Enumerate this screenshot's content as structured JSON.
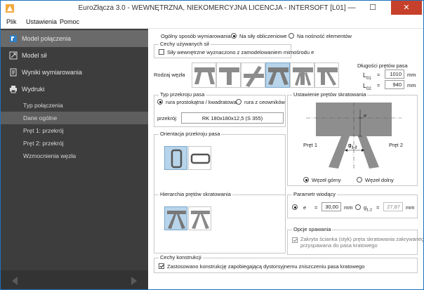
{
  "window": {
    "title": "EuroZłącza 3.0 - WEWNĘTRZNA, NIEKOMERCYJNA LICENCJA - INTERSOFT [L01]",
    "min_glyph": "—",
    "max_glyph": "☐",
    "close_glyph": "✕"
  },
  "menu": {
    "items": [
      "Plik",
      "Ustawienia",
      "Pomoc"
    ]
  },
  "sidebar": {
    "items": [
      {
        "label": "Model połączenia",
        "icon": "connection-model-icon"
      },
      {
        "label": "Model sił",
        "icon": "forces-icon"
      },
      {
        "label": "Wyniki wymiarowania",
        "icon": "results-icon"
      },
      {
        "label": "Wydruki",
        "icon": "printer-icon"
      }
    ],
    "subitems": [
      "Typ połączenia",
      "Dane ogólne",
      "Pręt 1: przekrój",
      "Pręt 2: przekrój",
      "Wzmocnienia węzła"
    ],
    "active_subitem": "Dane ogólne"
  },
  "design_method": {
    "label": "Ogólny sposób wymiarowania",
    "options": [
      "Na siły obliczeniowe",
      "Na nośność elementów"
    ],
    "selected": "Na siły obliczeniowe"
  },
  "forces_props": {
    "title": "Cechy używanych sił",
    "checkbox_label": "Siły wewnętrzne wyznaczono z zamodelowaniem mimośrodu e",
    "checked": false
  },
  "node_type": {
    "label": "Rodzaj węzła",
    "count": 6,
    "selected_index": 3
  },
  "chord_lengths": {
    "title": "Długości prętów pasa",
    "l01_label": "L",
    "l01_sub": "01",
    "l01_value": "1010",
    "l02_label": "L",
    "l02_sub": "02",
    "l02_value": "940",
    "eq": "=",
    "unit": "mm"
  },
  "chord_section_type": {
    "title": "Typ przekroju pasa",
    "options": [
      "rura prostokątna / kwadratowa",
      "rura z ceowników"
    ],
    "selected": "rura prostokątna / kwadratowa",
    "section_label": "przekrój:",
    "section_value": "RK 180x180x12,5 (S 355)"
  },
  "chord_orientation": {
    "title": "Orientacja przekroju pasa",
    "selected_index": 0
  },
  "brace_hierarchy": {
    "title": "Hierarchia prętów skratowania",
    "selected_index": 0
  },
  "brace_layout": {
    "title": "Ustawienie prętów skratowania",
    "e_label": "e",
    "bar1_label": "Pręt 1",
    "bar2_label": "Pręt 2",
    "gap_label": "g",
    "gap_sub": "1-2",
    "options": [
      "Węzeł górny",
      "Węzeł dolny"
    ],
    "selected": "Węzeł górny"
  },
  "leading_param": {
    "title": "Parametr wiodący",
    "e_label": "e",
    "e_value": "30,00",
    "g_label": "g",
    "g_sub": "1-2",
    "g_value": "27,87",
    "eq": "=",
    "unit": "mm",
    "selected": "e"
  },
  "welding": {
    "title": "Opcje spawania",
    "label_line1": "Zakryta ścianka (styk) pręta skratowania zakrywanego",
    "label_line2": "przyspawana do pasa kratowego",
    "checked": true,
    "disabled": true
  },
  "construction": {
    "title": "Cechy konstrukcji",
    "checkbox_label": "Zastosowano konstrukcję zapobiegającą dystorsyjnemu zniszczeniu pasa kratowego",
    "checked": true
  },
  "colors": {
    "sidebar_bg": "#3d3d3d",
    "selection": "#b7d4ea",
    "accent": "#1e73be",
    "close_button": "#c7402b"
  }
}
